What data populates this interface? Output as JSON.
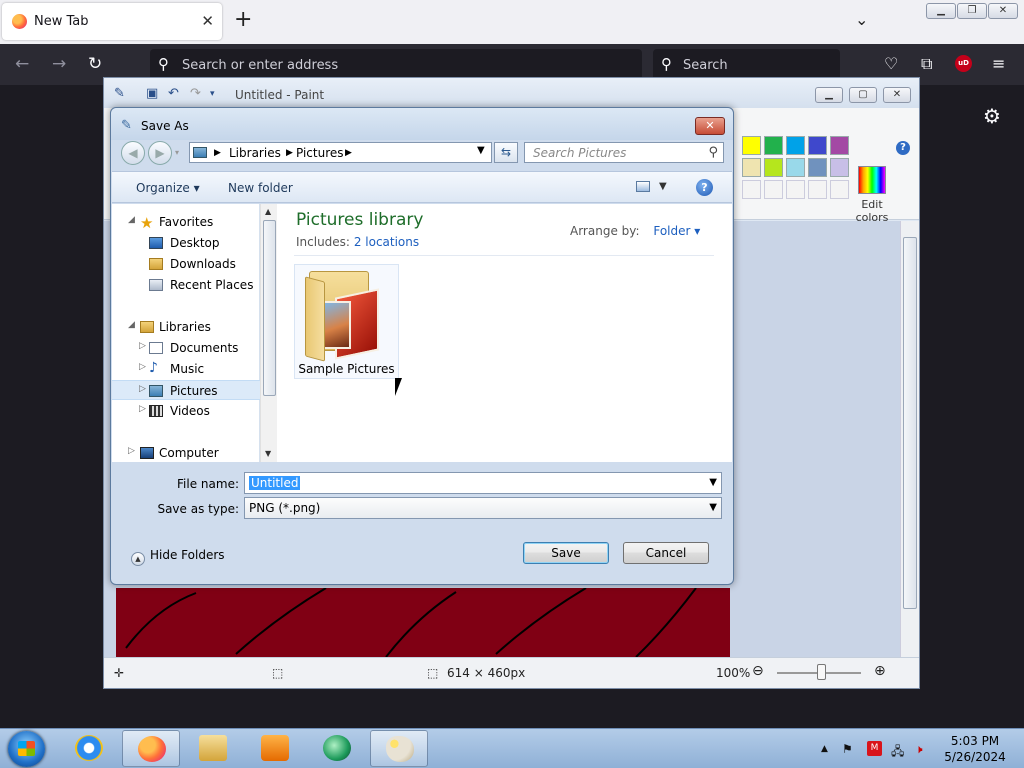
{
  "browser": {
    "tab_title": "New Tab",
    "tab_close": "✕",
    "new_tab": "+",
    "url_placeholder": "Search or enter address",
    "search_placeholder": "Search",
    "ublock_badge": "uD"
  },
  "paint": {
    "window_title": "Untitled - Paint",
    "edit_colors_label_1": "Edit",
    "edit_colors_label_2": "colors",
    "help": "?",
    "status_size": "614 × 460px",
    "zoom_level": "100%",
    "palette_colors": [
      "#ffff00",
      "#22b14c",
      "#00a2e8",
      "#3f48cc",
      "#a349a4",
      "#efe4b0",
      "#b5e61d",
      "#99d9ea",
      "#7092be",
      "#c8bfe7"
    ],
    "canvas_color": "#800014"
  },
  "dialog": {
    "title": "Save As",
    "close": "✕",
    "address": {
      "segments": [
        "Libraries",
        "Pictures"
      ]
    },
    "search_placeholder": "Search Pictures",
    "commands": {
      "organize": "Organize ▾",
      "new_folder": "New folder"
    },
    "help": "?",
    "nav": {
      "favorites": "Favorites",
      "desktop": "Desktop",
      "downloads": "Downloads",
      "recent_places": "Recent Places",
      "libraries": "Libraries",
      "documents": "Documents",
      "music": "Music",
      "pictures": "Pictures",
      "videos": "Videos",
      "computer": "Computer"
    },
    "library": {
      "title": "Pictures library",
      "includes_label": "Includes:",
      "includes_link": "2 locations",
      "arrange_label": "Arrange by:",
      "arrange_value": "Folder ▾"
    },
    "items": [
      {
        "label": "Sample Pictures"
      }
    ],
    "file_name_label": "File name:",
    "file_name_value": "Untitled",
    "save_type_label": "Save as type:",
    "save_type_value": "PNG (*.png)",
    "hide_folders": "Hide Folders",
    "save_button": "Save",
    "cancel_button": "Cancel"
  },
  "taskbar": {
    "time": "5:03 PM",
    "date": "5/26/2024"
  }
}
